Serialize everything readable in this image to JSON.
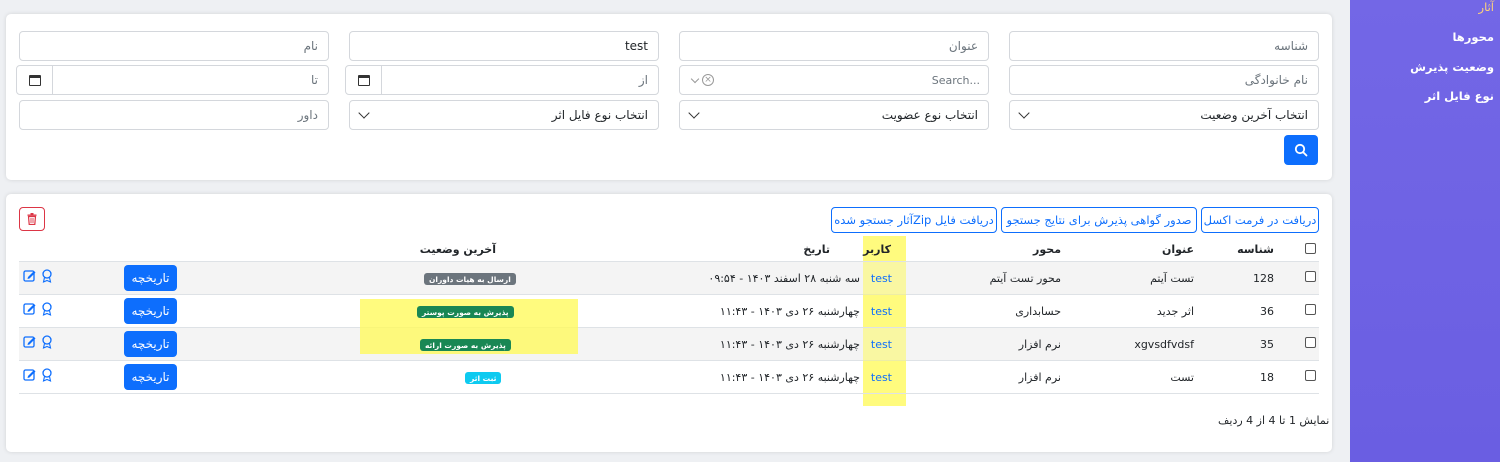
{
  "sidebar": {
    "items": [
      {
        "label": "آثار",
        "active": true
      },
      {
        "label": "محورها"
      },
      {
        "label": "وضعیت پذیرش"
      },
      {
        "label": "نوع فایل اثر"
      }
    ]
  },
  "filters": {
    "id_placeholder": "شناسه",
    "title_placeholder": "عنوان",
    "author_value": "test",
    "name_placeholder": "نام",
    "family_placeholder": "نام خانوادگی",
    "search_placeholder": "Search...",
    "from_placeholder": "از",
    "to_placeholder": "تا",
    "status_select": "انتخاب آخرین وضعیت",
    "membership_select": "انتخاب نوع عضویت",
    "filetype_select": "انتخاب نوع فایل اثر",
    "judge_placeholder": "داور"
  },
  "toolbar": {
    "excel": "دریافت در فرمت اکسل",
    "certificate": "صدور گواهی پذیرش برای نتایج جستجو",
    "zip": "دریافت فایل Zipآثار جستجو شده"
  },
  "table": {
    "headers": {
      "id": "شناسه",
      "title": "عنوان",
      "axis": "محور",
      "user": "کاربر",
      "date": "تاریخ",
      "status": "آخرین وضعیت"
    },
    "history_label": "تاریخچه",
    "rows": [
      {
        "id": "128",
        "title": "تست آیتم",
        "axis": "محور تست آیتم",
        "user": "test",
        "date": "سه شنبه ۲۸ اسفند ۱۴۰۳ - ۰۹:۵۴",
        "status": "ارسال به هیات داوران",
        "status_color": "#6c757d"
      },
      {
        "id": "36",
        "title": "اثر جدید",
        "axis": "حسابداری",
        "user": "test",
        "date": "چهارشنبه ۲۶ دی ۱۴۰۳ - ۱۱:۴۳",
        "status": "پذیرش به صورت پوستر",
        "status_color": "#198754"
      },
      {
        "id": "35",
        "title": "xgvsdfvdsf",
        "axis": "نرم افزار",
        "user": "test",
        "date": "چهارشنبه ۲۶ دی ۱۴۰۳ - ۱۱:۴۳",
        "status": "پذیرش به صورت ارائه",
        "status_color": "#198754"
      },
      {
        "id": "18",
        "title": "تست",
        "axis": "نرم افزار",
        "user": "test",
        "date": "چهارشنبه ۲۶ دی ۱۴۰۳ - ۱۱:۴۳",
        "status": "ثبت اثر",
        "status_color": "#0dcaf0"
      }
    ]
  },
  "footer": {
    "summary": "نمایش 1 تا 4 از 4 ردیف"
  },
  "colors": {
    "primary": "#0d6efd",
    "sidebar": "#7367e6",
    "highlight": "#fffa5a",
    "danger": "#dc3545"
  }
}
